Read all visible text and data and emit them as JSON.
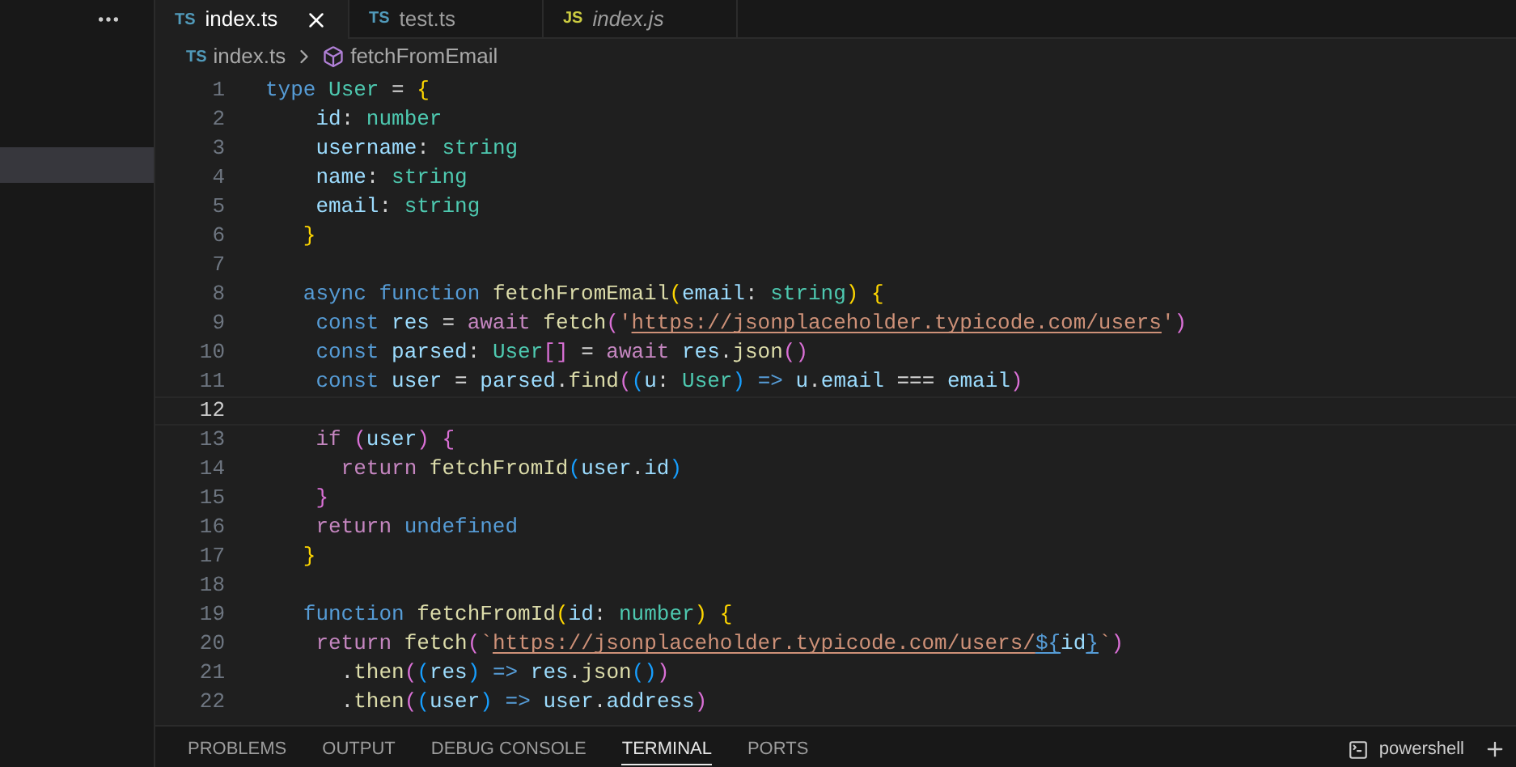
{
  "sidebar": {
    "has_selected_row": true
  },
  "tabs": [
    {
      "lang": "TS",
      "kind": "ts",
      "label": "index.ts",
      "selected": true,
      "preview": false
    },
    {
      "lang": "TS",
      "kind": "ts",
      "label": "test.ts",
      "selected": false,
      "preview": false
    },
    {
      "lang": "JS",
      "kind": "js",
      "label": "index.js",
      "selected": false,
      "preview": true
    }
  ],
  "breadcrumb": [
    {
      "kind": "file",
      "lang": "TS",
      "label": "index.ts"
    },
    {
      "kind": "symbol",
      "label": "fetchFromEmail"
    }
  ],
  "lines": [
    {
      "number": "1",
      "current": false,
      "tokens": [
        {
          "t": "type ",
          "kind": "kw"
        },
        {
          "t": "User",
          "kind": "type"
        },
        {
          "t": " = ",
          "kind": "op"
        },
        {
          "t": "{",
          "kind": "b1"
        }
      ]
    },
    {
      "number": "2",
      "current": false,
      "tokens": [
        {
          "t": "    id",
          "kind": "var"
        },
        {
          "t": ": ",
          "kind": "op"
        },
        {
          "t": "number",
          "kind": "type"
        }
      ]
    },
    {
      "number": "3",
      "current": false,
      "tokens": [
        {
          "t": "    username",
          "kind": "var"
        },
        {
          "t": ": ",
          "kind": "op"
        },
        {
          "t": "string",
          "kind": "type"
        }
      ]
    },
    {
      "number": "4",
      "current": false,
      "tokens": [
        {
          "t": "    name",
          "kind": "var"
        },
        {
          "t": ": ",
          "kind": "op"
        },
        {
          "t": "string",
          "kind": "type"
        }
      ]
    },
    {
      "number": "5",
      "current": false,
      "tokens": [
        {
          "t": "    email",
          "kind": "var"
        },
        {
          "t": ": ",
          "kind": "op"
        },
        {
          "t": "string",
          "kind": "type"
        }
      ]
    },
    {
      "number": "6",
      "current": false,
      "tokens": [
        {
          "t": "   }",
          "kind": "b1"
        }
      ]
    },
    {
      "number": "7",
      "current": false
    },
    {
      "number": "8",
      "current": false,
      "tokens": [
        {
          "t": "   async function ",
          "kind": "kw"
        },
        {
          "t": "fetchFromEmail",
          "kind": "fn"
        },
        {
          "t": "(",
          "kind": "b1"
        },
        {
          "t": "email",
          "kind": "var"
        },
        {
          "t": ": ",
          "kind": "op"
        },
        {
          "t": "string",
          "kind": "type"
        },
        {
          "t": ") {",
          "kind": "b1"
        }
      ]
    },
    {
      "number": "9",
      "current": false,
      "tokens": [
        {
          "t": "    const ",
          "kind": "kw"
        },
        {
          "t": "res",
          "kind": "var"
        },
        {
          "t": " = ",
          "kind": "op"
        },
        {
          "t": "await ",
          "kind": "ctl"
        },
        {
          "t": "fetch",
          "kind": "fn"
        },
        {
          "t": "(",
          "kind": "b2"
        },
        {
          "t": "'",
          "kind": "str"
        },
        {
          "t": "https://jsonplaceholder.typicode.com/users",
          "kind": "link"
        },
        {
          "t": "'",
          "kind": "str"
        },
        {
          "t": ")",
          "kind": "b2"
        }
      ]
    },
    {
      "number": "10",
      "current": false,
      "tokens": [
        {
          "t": "    const ",
          "kind": "kw"
        },
        {
          "t": "parsed",
          "kind": "var"
        },
        {
          "t": ": ",
          "kind": "op"
        },
        {
          "t": "User",
          "kind": "type"
        },
        {
          "t": "[]",
          "kind": "b2"
        },
        {
          "t": " = ",
          "kind": "op"
        },
        {
          "t": "await ",
          "kind": "ctl"
        },
        {
          "t": "res",
          "kind": "var"
        },
        {
          "t": ".",
          "kind": "op"
        },
        {
          "t": "json",
          "kind": "fn"
        },
        {
          "t": "()",
          "kind": "b2"
        }
      ]
    },
    {
      "number": "11",
      "current": false,
      "tokens": [
        {
          "t": "    const ",
          "kind": "kw"
        },
        {
          "t": "user",
          "kind": "var"
        },
        {
          "t": " = ",
          "kind": "op"
        },
        {
          "t": "parsed",
          "kind": "var"
        },
        {
          "t": ".",
          "kind": "op"
        },
        {
          "t": "find",
          "kind": "fn"
        },
        {
          "t": "(",
          "kind": "b2"
        },
        {
          "t": "(",
          "kind": "b3"
        },
        {
          "t": "u",
          "kind": "var"
        },
        {
          "t": ": ",
          "kind": "op"
        },
        {
          "t": "User",
          "kind": "type"
        },
        {
          "t": ")",
          "kind": "b3"
        },
        {
          "t": " => ",
          "kind": "kw"
        },
        {
          "t": "u",
          "kind": "var"
        },
        {
          "t": ".",
          "kind": "op"
        },
        {
          "t": "email",
          "kind": "var"
        },
        {
          "t": " === ",
          "kind": "op"
        },
        {
          "t": "email",
          "kind": "var"
        },
        {
          "t": ")",
          "kind": "b2"
        }
      ]
    },
    {
      "number": "12",
      "current": true
    },
    {
      "number": "13",
      "current": false,
      "tokens": [
        {
          "t": "    if ",
          "kind": "ctl"
        },
        {
          "t": "(",
          "kind": "b2"
        },
        {
          "t": "user",
          "kind": "var"
        },
        {
          "t": ") {",
          "kind": "b2"
        }
      ]
    },
    {
      "number": "14",
      "current": false,
      "tokens": [
        {
          "t": "      return ",
          "kind": "ctl"
        },
        {
          "t": "fetchFromId",
          "kind": "fn"
        },
        {
          "t": "(",
          "kind": "b3"
        },
        {
          "t": "user",
          "kind": "var"
        },
        {
          "t": ".",
          "kind": "op"
        },
        {
          "t": "id",
          "kind": "var"
        },
        {
          "t": ")",
          "kind": "b3"
        }
      ]
    },
    {
      "number": "15",
      "current": false,
      "tokens": [
        {
          "t": "    }",
          "kind": "b2"
        }
      ]
    },
    {
      "number": "16",
      "current": false,
      "tokens": [
        {
          "t": "    return ",
          "kind": "ctl"
        },
        {
          "t": "undefined",
          "kind": "kw"
        }
      ]
    },
    {
      "number": "17",
      "current": false,
      "tokens": [
        {
          "t": "   }",
          "kind": "b1"
        }
      ]
    },
    {
      "number": "18",
      "current": false
    },
    {
      "number": "19",
      "current": false,
      "tokens": [
        {
          "t": "   function ",
          "kind": "kw"
        },
        {
          "t": "fetchFromId",
          "kind": "fn"
        },
        {
          "t": "(",
          "kind": "b1"
        },
        {
          "t": "id",
          "kind": "var"
        },
        {
          "t": ": ",
          "kind": "op"
        },
        {
          "t": "number",
          "kind": "type"
        },
        {
          "t": ") {",
          "kind": "b1"
        }
      ]
    },
    {
      "number": "20",
      "current": false,
      "tokens": [
        {
          "t": "    return ",
          "kind": "ctl"
        },
        {
          "t": "fetch",
          "kind": "fn"
        },
        {
          "t": "(",
          "kind": "b2"
        },
        {
          "t": "`",
          "kind": "str"
        },
        {
          "t": "https://jsonplaceholder.typicode.com/users/",
          "kind": "link"
        },
        {
          "t": "${",
          "kind": "tpl"
        },
        {
          "t": "id",
          "kind": "var"
        },
        {
          "t": "}",
          "kind": "tpl"
        },
        {
          "t": "`",
          "kind": "str"
        },
        {
          "t": ")",
          "kind": "b2"
        }
      ]
    },
    {
      "number": "21",
      "current": false,
      "tokens": [
        {
          "t": "      .",
          "kind": "op"
        },
        {
          "t": "then",
          "kind": "fn"
        },
        {
          "t": "(",
          "kind": "b2"
        },
        {
          "t": "(",
          "kind": "b3"
        },
        {
          "t": "res",
          "kind": "var"
        },
        {
          "t": ")",
          "kind": "b3"
        },
        {
          "t": " => ",
          "kind": "kw"
        },
        {
          "t": "res",
          "kind": "var"
        },
        {
          "t": ".",
          "kind": "op"
        },
        {
          "t": "json",
          "kind": "fn"
        },
        {
          "t": "()",
          "kind": "b3"
        },
        {
          "t": ")",
          "kind": "b2"
        }
      ]
    },
    {
      "number": "22",
      "current": false,
      "tokens": [
        {
          "t": "      .",
          "kind": "op"
        },
        {
          "t": "then",
          "kind": "fn"
        },
        {
          "t": "(",
          "kind": "b2"
        },
        {
          "t": "(",
          "kind": "b3"
        },
        {
          "t": "user",
          "kind": "var"
        },
        {
          "t": ")",
          "kind": "b3"
        },
        {
          "t": " => ",
          "kind": "kw"
        },
        {
          "t": "user",
          "kind": "var"
        },
        {
          "t": ".",
          "kind": "op"
        },
        {
          "t": "address",
          "kind": "var"
        },
        {
          "t": ")",
          "kind": "b2"
        }
      ]
    }
  ],
  "panel": {
    "tabs": [
      {
        "label": "PROBLEMS",
        "selected": false
      },
      {
        "label": "OUTPUT",
        "selected": false
      },
      {
        "label": "DEBUG CONSOLE",
        "selected": false
      },
      {
        "label": "TERMINAL",
        "selected": true
      },
      {
        "label": "PORTS",
        "selected": false
      }
    ],
    "terminal": {
      "label": "powershell"
    }
  }
}
